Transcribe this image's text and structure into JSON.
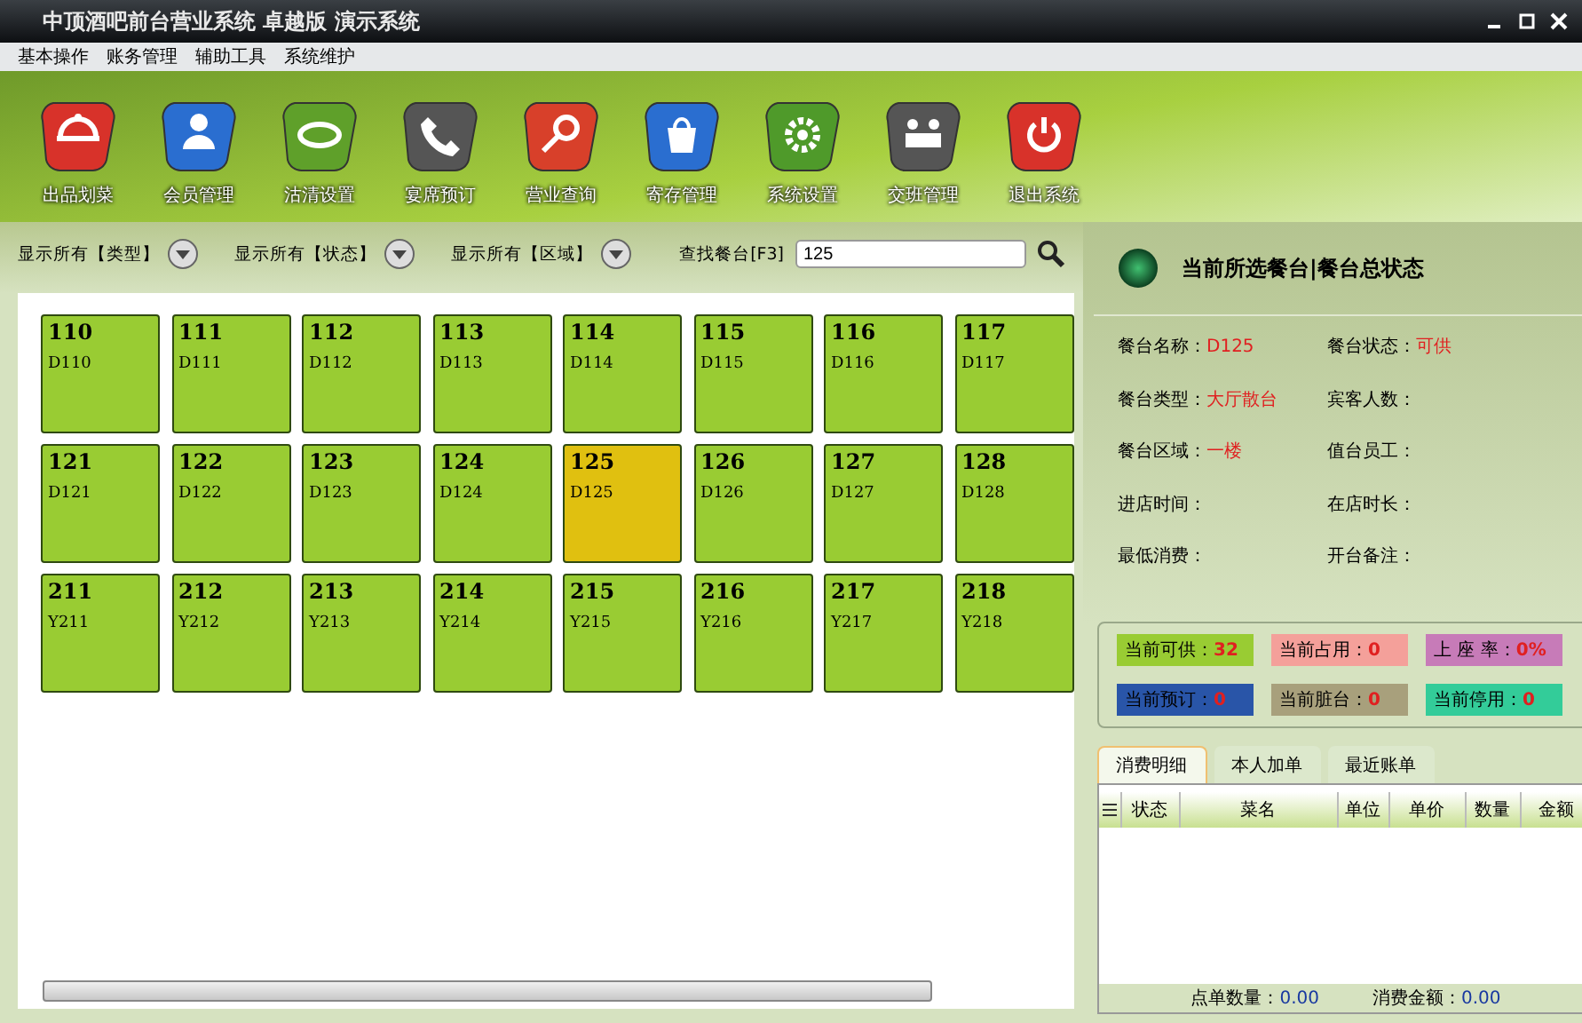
{
  "window": {
    "title": "中顶酒吧前台营业系统  卓越版  演示系统"
  },
  "menu": [
    "基本操作",
    "账务管理",
    "辅助工具",
    "系统维护"
  ],
  "toolbar": [
    "出品划菜",
    "会员管理",
    "沽清设置",
    "宴席预订",
    "营业查询",
    "寄存管理",
    "系统设置",
    "交班管理",
    "退出系统"
  ],
  "filters": [
    "显示所有【类型】",
    "显示所有【状态】",
    "显示所有【区域】"
  ],
  "search": {
    "label": "查找餐台[F3]",
    "value": "125"
  },
  "tables": [
    {
      "number": "110",
      "code": "D110",
      "selected": false
    },
    {
      "number": "111",
      "code": "D111",
      "selected": false
    },
    {
      "number": "112",
      "code": "D112",
      "selected": false
    },
    {
      "number": "113",
      "code": "D113",
      "selected": false
    },
    {
      "number": "114",
      "code": "D114",
      "selected": false
    },
    {
      "number": "115",
      "code": "D115",
      "selected": false
    },
    {
      "number": "116",
      "code": "D116",
      "selected": false
    },
    {
      "number": "117",
      "code": "D117",
      "selected": false
    },
    {
      "number": "121",
      "code": "D121",
      "selected": false
    },
    {
      "number": "122",
      "code": "D122",
      "selected": false
    },
    {
      "number": "123",
      "code": "D123",
      "selected": false
    },
    {
      "number": "124",
      "code": "D124",
      "selected": false
    },
    {
      "number": "125",
      "code": "D125",
      "selected": true
    },
    {
      "number": "126",
      "code": "D126",
      "selected": false
    },
    {
      "number": "127",
      "code": "D127",
      "selected": false
    },
    {
      "number": "128",
      "code": "D128",
      "selected": false
    },
    {
      "number": "211",
      "code": "Y211",
      "selected": false
    },
    {
      "number": "212",
      "code": "Y212",
      "selected": false
    },
    {
      "number": "213",
      "code": "Y213",
      "selected": false
    },
    {
      "number": "214",
      "code": "Y214",
      "selected": false
    },
    {
      "number": "215",
      "code": "Y215",
      "selected": false
    },
    {
      "number": "216",
      "code": "Y216",
      "selected": false
    },
    {
      "number": "217",
      "code": "Y217",
      "selected": false
    },
    {
      "number": "218",
      "code": "Y218",
      "selected": false
    }
  ],
  "panel": {
    "title": "当前所选餐台|餐台总状态",
    "fields": [
      {
        "label": "餐台名称：",
        "value": "D125"
      },
      {
        "label": "餐台状态：",
        "value": "可供"
      },
      {
        "label": "餐台类型：",
        "value": "大厅散台"
      },
      {
        "label": "宾客人数："
      },
      {
        "label": "餐台区域：",
        "value": "一楼"
      },
      {
        "label": "值台员工："
      },
      {
        "label": "进店时间："
      },
      {
        "label": "在店时长："
      },
      {
        "label": "最低消费："
      },
      {
        "label": "开台备注："
      }
    ],
    "stats": [
      {
        "label": "当前可供：",
        "value": "32",
        "color": "#99cc33"
      },
      {
        "label": "当前占用：",
        "value": "0",
        "color": "#f4a09a"
      },
      {
        "label": "上 座 率：",
        "value": "0%",
        "color": "#c77bb8"
      },
      {
        "label": "当前预订：",
        "value": "0",
        "color": "#2955a8"
      },
      {
        "label": "当前脏台：",
        "value": "0",
        "color": "#a8a07c"
      },
      {
        "label": "当前停用：",
        "value": "0",
        "color": "#33cc99"
      }
    ]
  },
  "tabs": [
    {
      "label": "消费明细",
      "selected": true
    },
    {
      "label": "本人加单",
      "selected": false
    },
    {
      "label": "最近账单",
      "selected": false
    }
  ],
  "order_table": {
    "columns": [
      "状态",
      "菜名",
      "单位",
      "单价",
      "数量",
      "金额"
    ]
  },
  "summary": [
    {
      "label": "点单数量：",
      "value": "0.00"
    },
    {
      "label": "消费金额：",
      "value": "0.00"
    }
  ]
}
